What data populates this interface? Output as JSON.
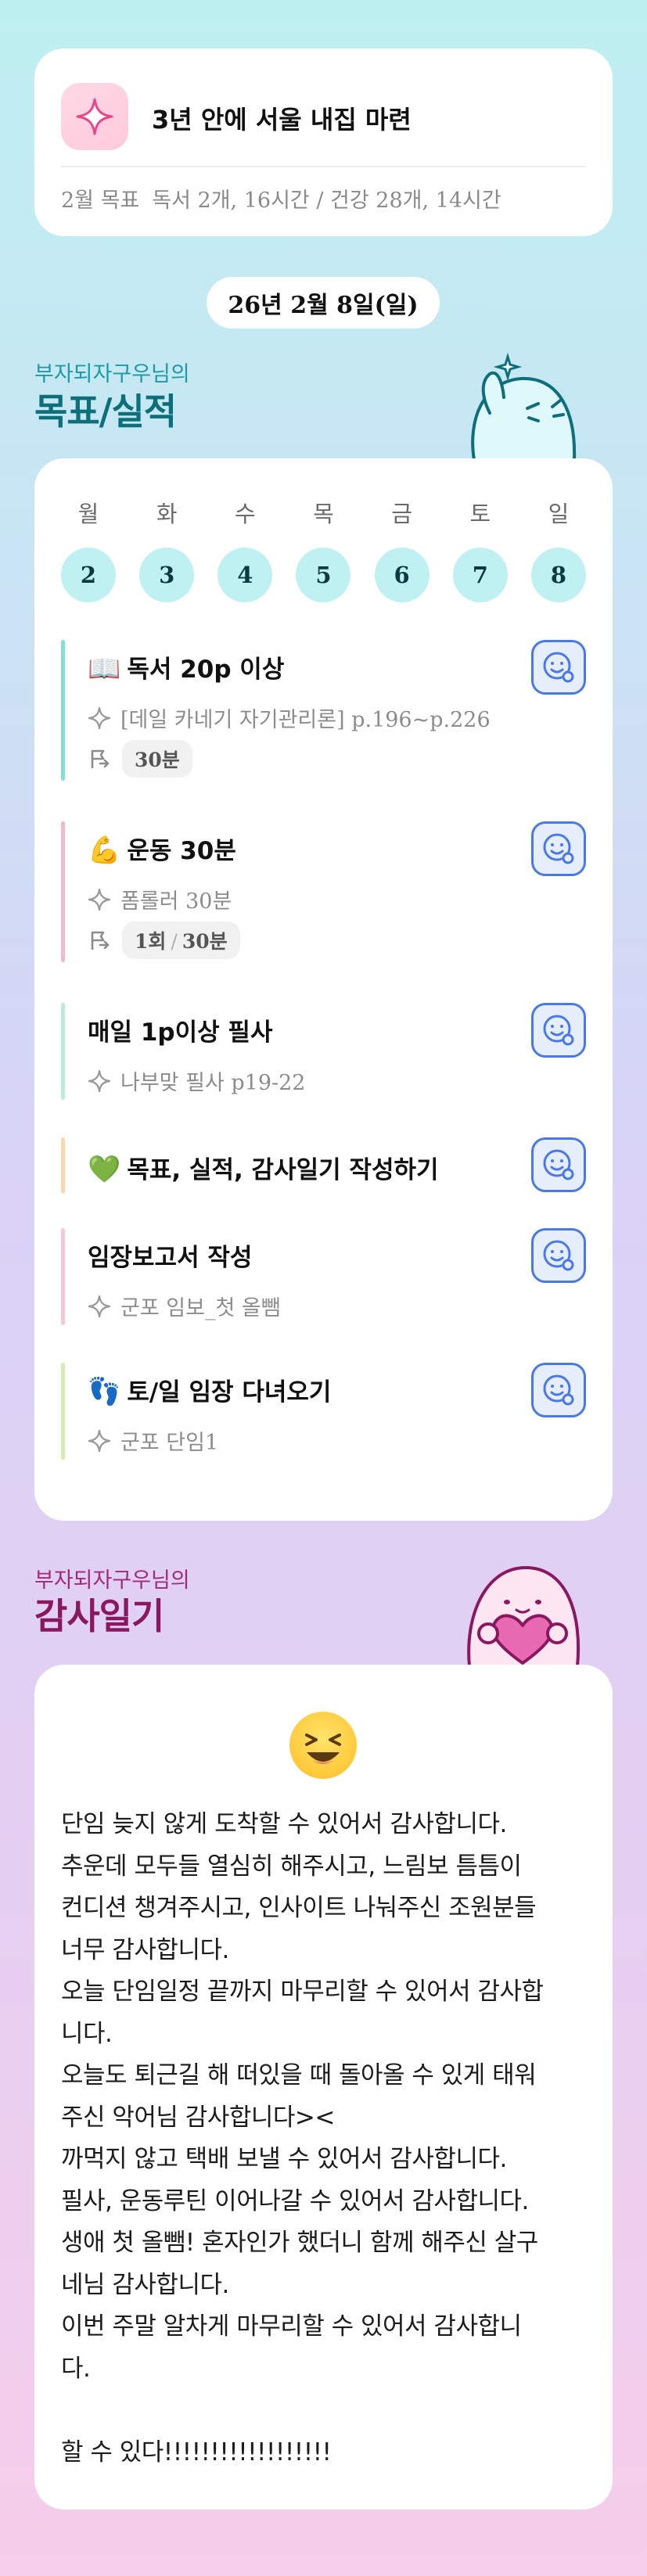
{
  "goal": {
    "title": "3년 안에 서울 내집 마련",
    "month_label": "2월 목표",
    "summary": "독서 2개, 16시간 / 건강 28개, 14시간",
    "icon": "sparkle-icon"
  },
  "date": "26년 2월 8일(일)",
  "goals_section": {
    "owner": "부자되자구우님의",
    "title": "목표/실적"
  },
  "week": [
    {
      "label": "월",
      "num": "2"
    },
    {
      "label": "화",
      "num": "3"
    },
    {
      "label": "수",
      "num": "4"
    },
    {
      "label": "목",
      "num": "5"
    },
    {
      "label": "금",
      "num": "6"
    },
    {
      "label": "토",
      "num": "7"
    },
    {
      "label": "일",
      "num": "8"
    }
  ],
  "tasks": [
    {
      "emoji": "📖",
      "title": "독서 20p 이상",
      "sub": "[데일 카네기 자기관리론] p.196~p.226",
      "time": "30분",
      "bar_color": "#7fe0d4"
    },
    {
      "emoji": "💪",
      "title": "운동 30분",
      "sub": "폼롤러 30분",
      "count": "1회",
      "time": "30분",
      "bar_color": "#f7b6cf"
    },
    {
      "emoji": "",
      "title": "매일 1p이상 필사",
      "sub": "나부맞 필사 p19-22",
      "bar_color": "#b9ecd4"
    },
    {
      "emoji": "💚",
      "title": "목표, 실적, 감사일기 작성하기",
      "bar_color": "#ffd6a8"
    },
    {
      "emoji": "",
      "title": "임장보고서 작성",
      "sub": "군포 임보_첫 올뺌",
      "bar_color": "#f9c6d8"
    },
    {
      "emoji": "👣",
      "title": "토/일 임장 다녀오기",
      "sub": "군포 단임1",
      "bar_color": "#d0eeb0"
    }
  ],
  "thanks_section": {
    "owner": "부자되자구우님의",
    "title": "감사일기"
  },
  "thanks": {
    "emoji": "😆",
    "lines": [
      "단임 늦지 않게 도착할 수 있어서 감사합니다.",
      "추운데 모두들 열심히 해주시고, 느림보 틈틈이",
      "컨디션 챙겨주시고, 인사이트 나눠주신 조원분들",
      "너무 감사합니다.",
      "오늘 단임일정 끝까지 마무리할 수 있어서 감사합",
      "니다.",
      "오늘도 퇴근길 해 떠있을 때 돌아올 수 있게 태워",
      "주신 악어님 감사합니다><",
      "까먹지 않고 택배 보낼 수 있어서 감사합니다.",
      "필사, 운동루틴 이어나갈 수 있어서 감사합니다.",
      "생애 첫 올뺌! 혼자인가 했더니 함께 해주신 살구",
      "네님 감사합니다.",
      "이번 주말 알차게 마무리할 수 있어서 감사합니",
      "다.",
      "",
      "할 수 있다!!!!!!!!!!!!!!!!!!"
    ]
  }
}
